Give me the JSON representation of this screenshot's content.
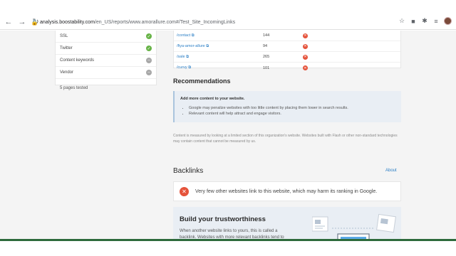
{
  "browser": {
    "url_host": "analysis.boostability.com",
    "url_path": "/en_US/reports/www.amorallure.com#/Test_Site_IncomingLinks"
  },
  "left_panel": {
    "rows": [
      {
        "label": "SSL",
        "status": "pass"
      },
      {
        "label": "Twitter",
        "status": "pass"
      },
      {
        "label": "Content keywords",
        "status": "neutral"
      },
      {
        "label": "Vendor",
        "status": "neutral"
      }
    ],
    "pages_tested": "5 pages tested"
  },
  "link_table": {
    "rows": [
      {
        "path": "/contact",
        "count": "144"
      },
      {
        "path": "/fiya-amor-allure",
        "count": "94"
      },
      {
        "path": "/sale",
        "count": "265"
      },
      {
        "path": "/curvy",
        "count": "101"
      }
    ]
  },
  "recommendations": {
    "title": "Recommendations",
    "heading": "Add more content to your website.",
    "bullets": [
      "Google may penalize websites with too little content by placing them lower in search results.",
      "Relevant content will help attract and engage visitors."
    ],
    "note": "Content is measured by looking at a limited section of this organization's website. Websites built with Flash or other non-standard technologies may contain content that cannot be measured by us."
  },
  "backlinks": {
    "title": "Backlinks",
    "about": "About",
    "alert": "Very few other websites link to this website, which may harm its ranking in Google.",
    "trust_title": "Build your trustworthiness",
    "trust_text": "When another website links to yours, this is called a backlink. Websites with more relevant backlinks tend to"
  },
  "colors": {
    "pass": "#67b347",
    "neutral": "#a8a8a8",
    "fail": "#e5533b",
    "link": "#2a7ec5",
    "rec_bg": "#e9eef4"
  },
  "icons": [
    "back-arrow-icon",
    "forward-arrow-icon",
    "reload-icon",
    "lock-icon",
    "star-icon",
    "extension-icon",
    "puzzle-icon",
    "check-icon",
    "external-link-icon",
    "close-icon"
  ]
}
